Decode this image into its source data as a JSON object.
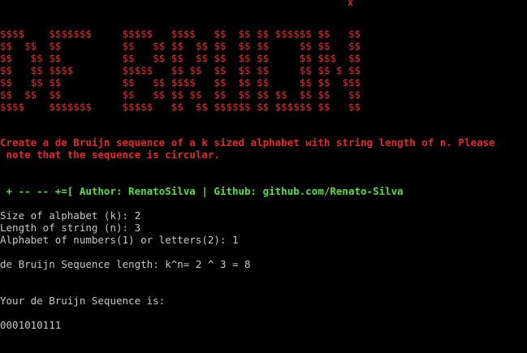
{
  "window": {
    "close_glyph": "x"
  },
  "banner": {
    "lines": [
      "$$$$    $$$$$$$     $$$$$   $$$$   $$  $$ $$ $$$$$$ $$   $$",
      "$$  $$  $$          $$   $$ $$  $$ $$  $$ $$     $$ $$   $$",
      "$$   $$ $$          $$   $$ $$  $$ $$  $$ $$     $$ $$$  $$",
      "$$   $$ $$$$        $$$$$   $$ $$  $$  $$ $$     $$ $$ $ $$",
      "$$   $$ $$          $$   $$ $$$$   $$  $$ $$     $$ $$  $$$",
      "$$  $$  $$          $$   $$ $$ $$  $$  $$ $$ $$  $$ $$   $$",
      "$$$$    $$$$$$$     $$$$$   $$  $$ $$$$$$ $$ $$$$$$ $$   $$"
    ]
  },
  "description": {
    "line1": "Create a de Bruijn sequence of a k sized alphabet with string length of n. Please",
    "line2": " note that the sequence is circular."
  },
  "author_line": " + -- -- +=[ Author: RenatoSilva | Github: github.com/Renato-Silva",
  "inputs": {
    "alphabet_size": "Size of alphabet (k): 2",
    "string_length": "Length of string (n): 3",
    "alphabet_type": "Alphabet of numbers(1) or letters(2): 1"
  },
  "sequence_length_line": "de Bruijn Sequence length: k^n= 2 ^ 3 = 8",
  "result_label": "Your de Bruijn Sequence is:",
  "result_value": "0001010111",
  "colors": {
    "background": "#000000",
    "banner_red": "#e8262b",
    "author_green": "#55e03a",
    "text_gray": "#c8c8c8"
  }
}
